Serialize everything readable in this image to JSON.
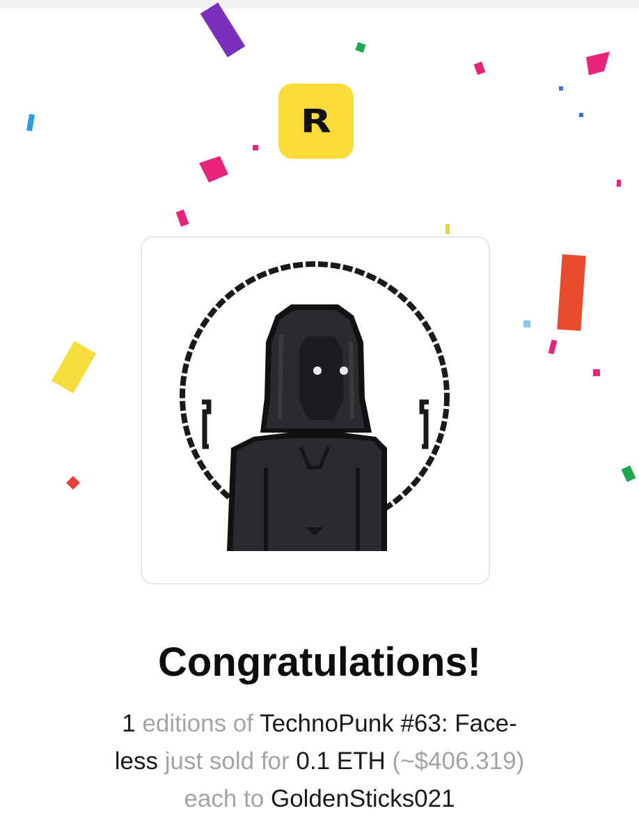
{
  "logo": {
    "letter": "R",
    "background_color": "#F9DC3A"
  },
  "artwork": {
    "icon": "hooded-faceless-pixel-figure",
    "background_color": "#FFFFFF"
  },
  "heading": "Congratulations!",
  "sale": {
    "quantity": "1",
    "editions_text": "editions of",
    "artwork_name_part1": "TechnoPunk #63: Face-",
    "artwork_name_part2": "less",
    "sold_text": "just sold for",
    "price": "0.1 ETH",
    "usd_value": "(~$406.319)",
    "each_to_text": "each to",
    "buyer": "GoldenSticks021"
  },
  "colors": {
    "text_primary": "#1A1A1A",
    "text_muted": "#A3A3A3"
  }
}
